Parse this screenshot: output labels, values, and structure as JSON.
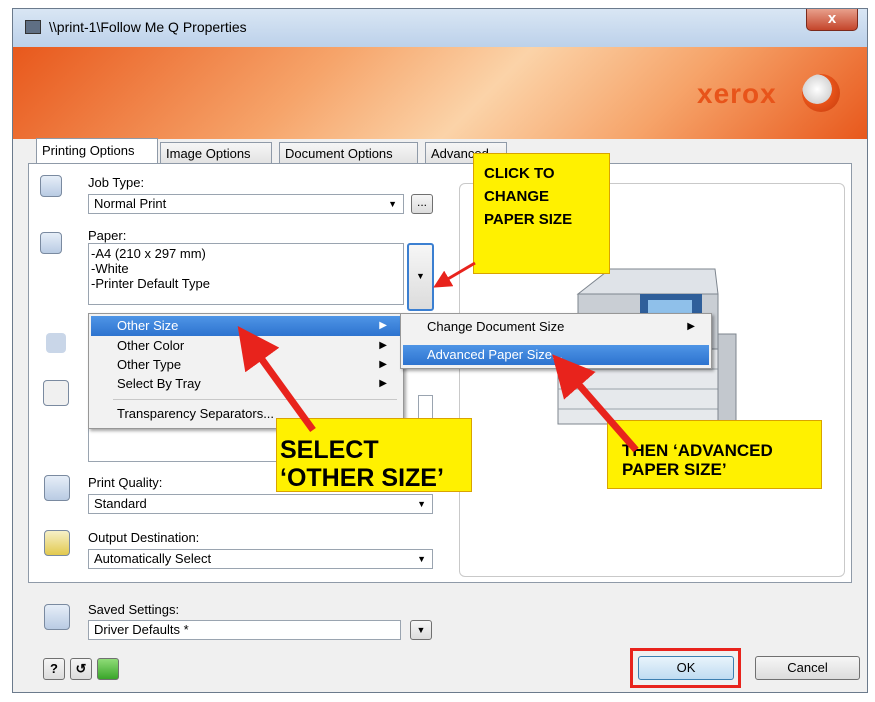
{
  "window": {
    "title": "\\\\print-1\\Follow Me Q Properties",
    "close_label": "x",
    "brand": "xerox"
  },
  "tabs": [
    {
      "label": "Printing Options"
    },
    {
      "label": "Image Options"
    },
    {
      "label": "Document Options"
    },
    {
      "label": "Advanced"
    }
  ],
  "job_type": {
    "label": "Job Type:",
    "value": "Normal Print",
    "more_label": "..."
  },
  "paper": {
    "label": "Paper:",
    "lines": [
      "-A4 (210 x 297 mm)",
      "-White",
      "-Printer Default Type"
    ]
  },
  "paper_menu": {
    "items": [
      "Other Size",
      "Other Color",
      "Other Type",
      "Select By Tray",
      "Transparency Separators..."
    ]
  },
  "submenu": {
    "items": [
      "Change Document Size",
      "Advanced Paper Size..."
    ]
  },
  "print_quality": {
    "label": "Print Quality:",
    "value": "Standard"
  },
  "output_destination": {
    "label": "Output Destination:",
    "value": "Automatically Select"
  },
  "saved_settings": {
    "label": "Saved Settings:",
    "value": "Driver Defaults *"
  },
  "buttons": {
    "help": "?",
    "ok": "OK",
    "cancel": "Cancel"
  },
  "annotations": {
    "click_to_change": "CLICK TO CHANGE PAPER SIZE",
    "select_other": [
      "SELECT",
      "‘OTHER SIZE’"
    ],
    "then_advanced": [
      "THEN ‘ADVANCED",
      "PAPER SIZE’"
    ]
  },
  "colors": {
    "accent_red": "#e8231c",
    "highlight": "#fff100",
    "selection": "#3a80d8",
    "brand_orange": "#e8541a"
  }
}
